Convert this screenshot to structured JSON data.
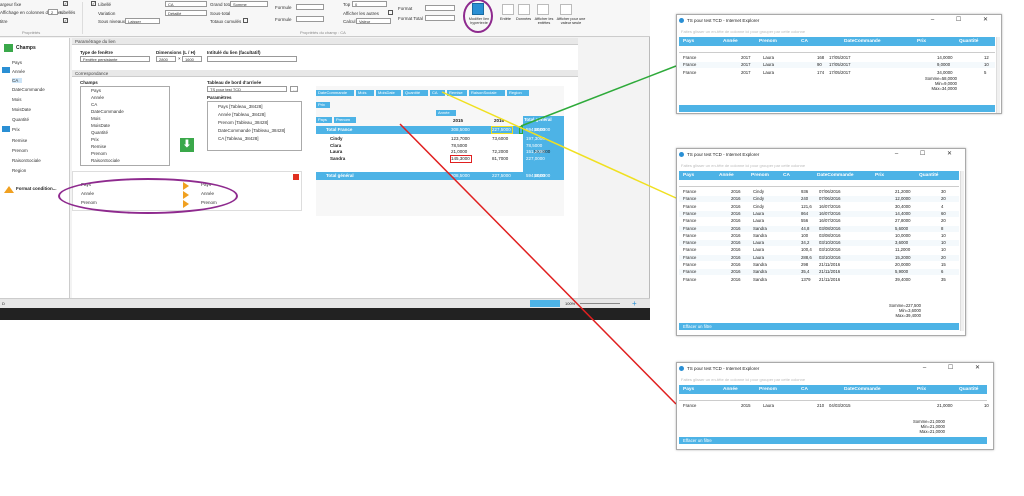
{
  "ribbon": {
    "row1": [
      "Largeur fixe",
      "Libellé",
      "CA",
      "Grand total",
      "Somme",
      "Formule",
      "Top",
      "Format",
      "Modifier lien hypertexte",
      "Entête",
      "Données",
      "Afficher les entêtes",
      "Afficher pour une valeur seule"
    ],
    "largeur_fixe": "argeur fixe",
    "affichage_colonnes": "Affichage en colonnes données",
    "affichage_value": "2",
    "libelles": "Libellés",
    "titre": "titre",
    "libelle": "Libellé",
    "variation": "Variation",
    "sous_niveaux": "Sous niveaux",
    "sous_niveaux_value": "Laisser",
    "field_value": "CA",
    "detail_value": "Détaillé",
    "grand_total": "Grand total",
    "grand_total_value": "Somme",
    "sous_total": "Sous-total",
    "totaux_cumules": "Totaux cumulés",
    "formule1": "Formule",
    "formule2": "Formule",
    "top": "Top",
    "top_value": "0",
    "afficher_autres": "Afficher les autres",
    "calcul": "Calcul",
    "calcul_value": "Valeur",
    "format": "Format",
    "format_total": "Format Total",
    "modifier_lien": "Modifier lien hypertexte",
    "entete": "Entête",
    "donnees": "Données",
    "afficher_entetes": "Afficher les entêtes",
    "afficher_valeur_seule": "Afficher pour une valeur seule",
    "group_proprietes": "Propriétés",
    "group_champ": "Propriétés du champ : CA"
  },
  "leftnav": {
    "champs_label": "Champs",
    "items": [
      "Pays",
      "Année",
      "CA",
      "DateCommande",
      "Mois",
      "MoisDate",
      "Quantité",
      "Prix",
      "Remise",
      "Prenom",
      "RaisonSociale",
      "Region"
    ],
    "format_label": "Format condition..."
  },
  "main": {
    "parametrage_head": "Paramétrage du lien",
    "type_fenetre_label": "Type de fenêtre",
    "type_fenetre_value": "Fenêtre persistante",
    "dimensions_label": "Dimensions (L / H)",
    "dim_l": "2800",
    "dim_h": "1600",
    "intitule_label": "Intitulé du lien (facultatif)",
    "correspondance_head": "Correspondance",
    "champs_label": "Champs",
    "champs_list": [
      "Pays",
      "Année",
      "CA",
      "DateCommande",
      "Mois",
      "MoisDate",
      "Quantité",
      "Prix",
      "Remise",
      "Prenom",
      "RaisonSociale"
    ],
    "tableau_label": "Tableau de bord d'arrivée",
    "tableau_value": "TS pour test TCD",
    "parametres_label": "Paramètres",
    "parametres_list": [
      "Pays [Tableau_38428]",
      "Année [Tableau_38428]",
      "Prenom [Tableau_38428]",
      "DateCommande [Tableau_38428]",
      "CA [Tableau_38428]"
    ],
    "mapping": [
      {
        "from": "Pays",
        "to": "Pays"
      },
      {
        "from": "Année",
        "to": "Année"
      },
      {
        "from": "Prenom",
        "to": "Prenom"
      }
    ],
    "zoom": "100%"
  },
  "pivot": {
    "filter_fields": [
      "DateCommande",
      "Mois",
      "MoisDate",
      "Quantité",
      "CA",
      "Remise",
      "RaisonSociale",
      "Region"
    ],
    "prix": "Prix",
    "annee": "Année",
    "row_fields": [
      "Pays",
      "Prenom"
    ],
    "years": [
      "2015",
      "2016",
      "2017",
      "Total général"
    ],
    "rows": [
      {
        "label": "Total France",
        "v": [
          "308,5000",
          "227,5000",
          "58,0000",
          "594,0000"
        ]
      },
      {
        "label": "Cindy",
        "v": [
          "123,7000",
          "73,6000",
          "",
          "197,3000"
        ]
      },
      {
        "label": "Clara",
        "v": [
          "78,5000",
          "",
          "",
          "78,5000"
        ]
      },
      {
        "label": "Laura",
        "v": [
          "21,0000",
          "72,2000",
          "58,0000",
          "151,2000"
        ]
      },
      {
        "label": "Sandra",
        "v": [
          "145,3000",
          "81,7000",
          "",
          "227,0000"
        ]
      },
      {
        "label": "Total général",
        "v": [
          "308,5000",
          "227,5000",
          "58,0000",
          "594,0000"
        ]
      }
    ]
  },
  "ie_common": {
    "title": "TS pour test TCD - Internet Explorer",
    "group_hint": "Faites glisser un en-tête de colonne ici pour grouper par cette colonne",
    "headers": [
      "Pays",
      "Année",
      "Prenom",
      "CA",
      "DateCommande",
      "Prix",
      "Quantité"
    ],
    "effacer": "Effacer un filtre"
  },
  "ie1": {
    "rows": [
      [
        "France",
        "2017",
        "Laura",
        "168",
        "17/05/2017",
        "14,0000",
        "12"
      ],
      [
        "France",
        "2017",
        "Laura",
        "90",
        "17/05/2017",
        "9,0000",
        "10"
      ],
      [
        "France",
        "2017",
        "Laura",
        "174",
        "17/05/2017",
        "34,0000",
        "5"
      ]
    ],
    "stats": [
      "Somme=58,0000",
      "Min=9,0000",
      "Max=34,0000"
    ]
  },
  "ie2": {
    "rows": [
      [
        "France",
        "2016",
        "Cindy",
        "936",
        "07/06/2016",
        "21,2000",
        "30"
      ],
      [
        "France",
        "2016",
        "Cindy",
        "240",
        "07/06/2016",
        "12,0000",
        "20"
      ],
      [
        "France",
        "2016",
        "Cindy",
        "121,6",
        "16/07/2016",
        "30,4000",
        "4"
      ],
      [
        "France",
        "2016",
        "Laura",
        "864",
        "16/07/2016",
        "14,4000",
        "60"
      ],
      [
        "France",
        "2016",
        "Laura",
        "556",
        "16/07/2016",
        "27,8000",
        "20"
      ],
      [
        "France",
        "2016",
        "Sandra",
        "44,8",
        "03/08/2016",
        "5,6000",
        "8"
      ],
      [
        "France",
        "2016",
        "Sandra",
        "100",
        "03/08/2016",
        "10,0000",
        "10"
      ],
      [
        "France",
        "2016",
        "Laura",
        "34,2",
        "03/10/2016",
        "3,6000",
        "10"
      ],
      [
        "France",
        "2016",
        "Laura",
        "100,4",
        "03/10/2016",
        "11,2000",
        "10"
      ],
      [
        "France",
        "2016",
        "Laura",
        "288,6",
        "03/10/2016",
        "15,2000",
        "20"
      ],
      [
        "France",
        "2016",
        "Sandra",
        "298",
        "21/11/2016",
        "20,0000",
        "15"
      ],
      [
        "France",
        "2016",
        "Sandra",
        "35,4",
        "21/11/2016",
        "5,9000",
        "6"
      ],
      [
        "France",
        "2016",
        "Sandra",
        "1379",
        "21/11/2016",
        "39,4000",
        "35"
      ]
    ],
    "stats": [
      "Somme=227,500",
      "Min=3,6000",
      "Max=39,4000"
    ]
  },
  "ie3": {
    "rows": [
      [
        "France",
        "2015",
        "Laura",
        "210",
        "04/03/2015",
        "21,0000",
        "10"
      ]
    ],
    "stats": [
      "Somme=21,0000",
      "Min=21,0000",
      "Max=21,0000"
    ]
  },
  "colors": {
    "accent": "#4db3e6",
    "green": "#2eaa3a",
    "yellow": "#f0e020",
    "red": "#e02020",
    "purple": "#8e2a8e"
  }
}
